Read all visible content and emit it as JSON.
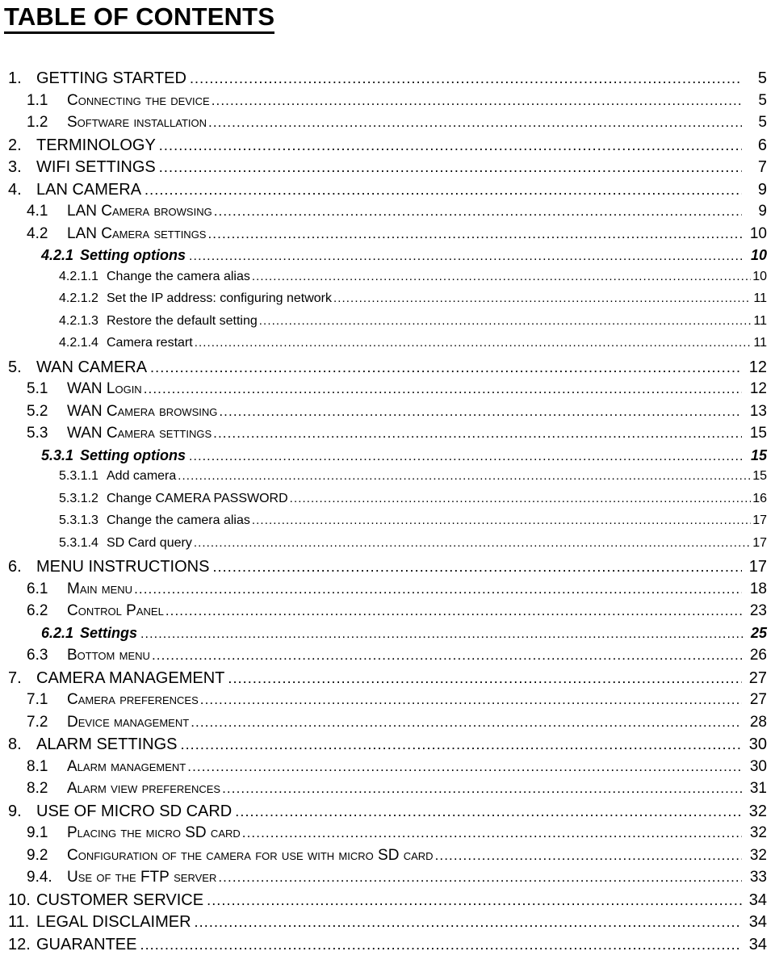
{
  "document": {
    "title": "TABLE OF CONTENTS"
  },
  "toc": {
    "entries": [
      {
        "level": 1,
        "number": "1.",
        "label": "GETTING STARTED",
        "page": "5"
      },
      {
        "level": 2,
        "number": "1.1",
        "label": "Connecting the device",
        "page": "5"
      },
      {
        "level": 2,
        "number": "1.2",
        "label": "Software installation",
        "page": "5"
      },
      {
        "level": 1,
        "number": "2.",
        "label": "TERMINOLOGY",
        "page": "6"
      },
      {
        "level": 1,
        "number": "3.",
        "label": "WIFI SETTINGS",
        "page": "7"
      },
      {
        "level": 1,
        "number": "4.",
        "label": "LAN CAMERA",
        "page": "9"
      },
      {
        "level": 2,
        "number": "4.1",
        "label": "LAN Camera browsing",
        "page": "9"
      },
      {
        "level": 2,
        "number": "4.2",
        "label": "LAN Camera settings",
        "page": "10"
      },
      {
        "level": 3,
        "number": "4.2.1",
        "label": "Setting options",
        "page": "10"
      },
      {
        "level": 4,
        "number": "4.2.1.1",
        "label": "Change the camera alias",
        "page": "10"
      },
      {
        "level": 4,
        "number": "4.2.1.2",
        "label": "Set the IP address: configuring network",
        "page": "11"
      },
      {
        "level": 4,
        "number": "4.2.1.3",
        "label": "Restore the default setting",
        "page": "11"
      },
      {
        "level": 4,
        "number": "4.2.1.4",
        "label": "Camera restart",
        "page": "11"
      },
      {
        "level": 1,
        "number": "5.",
        "label": "WAN CAMERA",
        "page": "12"
      },
      {
        "level": 2,
        "number": "5.1",
        "label": "WAN Login",
        "page": "12"
      },
      {
        "level": 2,
        "number": "5.2",
        "label": "WAN Camera browsing",
        "page": "13"
      },
      {
        "level": 2,
        "number": "5.3",
        "label": "WAN Camera settings",
        "page": "15"
      },
      {
        "level": 3,
        "number": "5.3.1",
        "label": "Setting options",
        "page": "15"
      },
      {
        "level": 4,
        "number": "5.3.1.1",
        "label": "Add camera",
        "page": "15"
      },
      {
        "level": 4,
        "number": "5.3.1.2",
        "label": "Change CAMERA PASSWORD",
        "page": "16"
      },
      {
        "level": 4,
        "number": "5.3.1.3",
        "label": "Change the camera alias",
        "page": "17"
      },
      {
        "level": 4,
        "number": "5.3.1.4",
        "label": "SD Card query",
        "page": "17"
      },
      {
        "level": 1,
        "number": "6.",
        "label": "MENU INSTRUCTIONS",
        "page": "17"
      },
      {
        "level": 2,
        "number": "6.1",
        "label": "Main menu",
        "page": "18"
      },
      {
        "level": 2,
        "number": "6.2",
        "label": "Control Panel",
        "page": "23"
      },
      {
        "level": 3,
        "number": "6.2.1",
        "label": "Settings",
        "page": "25"
      },
      {
        "level": 2,
        "number": "6.3",
        "label": "Bottom menu",
        "page": "26"
      },
      {
        "level": 1,
        "number": "7.",
        "label": "CAMERA MANAGEMENT",
        "page": "27"
      },
      {
        "level": 2,
        "number": "7.1",
        "label": "Camera preferences",
        "page": "27"
      },
      {
        "level": 2,
        "number": "7.2",
        "label": "Device management",
        "page": "28"
      },
      {
        "level": 1,
        "number": "8.",
        "label": "ALARM SETTINGS",
        "page": "30"
      },
      {
        "level": 2,
        "number": "8.1",
        "label": "Alarm management",
        "page": "30"
      },
      {
        "level": 2,
        "number": "8.2",
        "label": "Alarm view preferences",
        "page": "31"
      },
      {
        "level": 1,
        "number": "9.",
        "label": "USE OF MICRO SD CARD",
        "page": "32"
      },
      {
        "level": 2,
        "number": "9.1",
        "label": "Placing the micro SD card",
        "page": "32",
        "acronyms": [
          "SD"
        ]
      },
      {
        "level": 2,
        "number": "9.2",
        "label": "Configuration of the camera for use with micro SD card",
        "page": "32",
        "acronyms": [
          "SD"
        ]
      },
      {
        "level": 2,
        "number": "9.4.",
        "label": "Use of the FTP server",
        "page": "33",
        "acronyms": [
          "FTP"
        ]
      },
      {
        "level": 1,
        "number": "10.",
        "label": "CUSTOMER SERVICE",
        "page": "34"
      },
      {
        "level": 1,
        "number": "11.",
        "label": "LEGAL DISCLAIMER",
        "page": "34"
      },
      {
        "level": 1,
        "number": "12.",
        "label": "GUARANTEE",
        "page": "34"
      }
    ]
  }
}
